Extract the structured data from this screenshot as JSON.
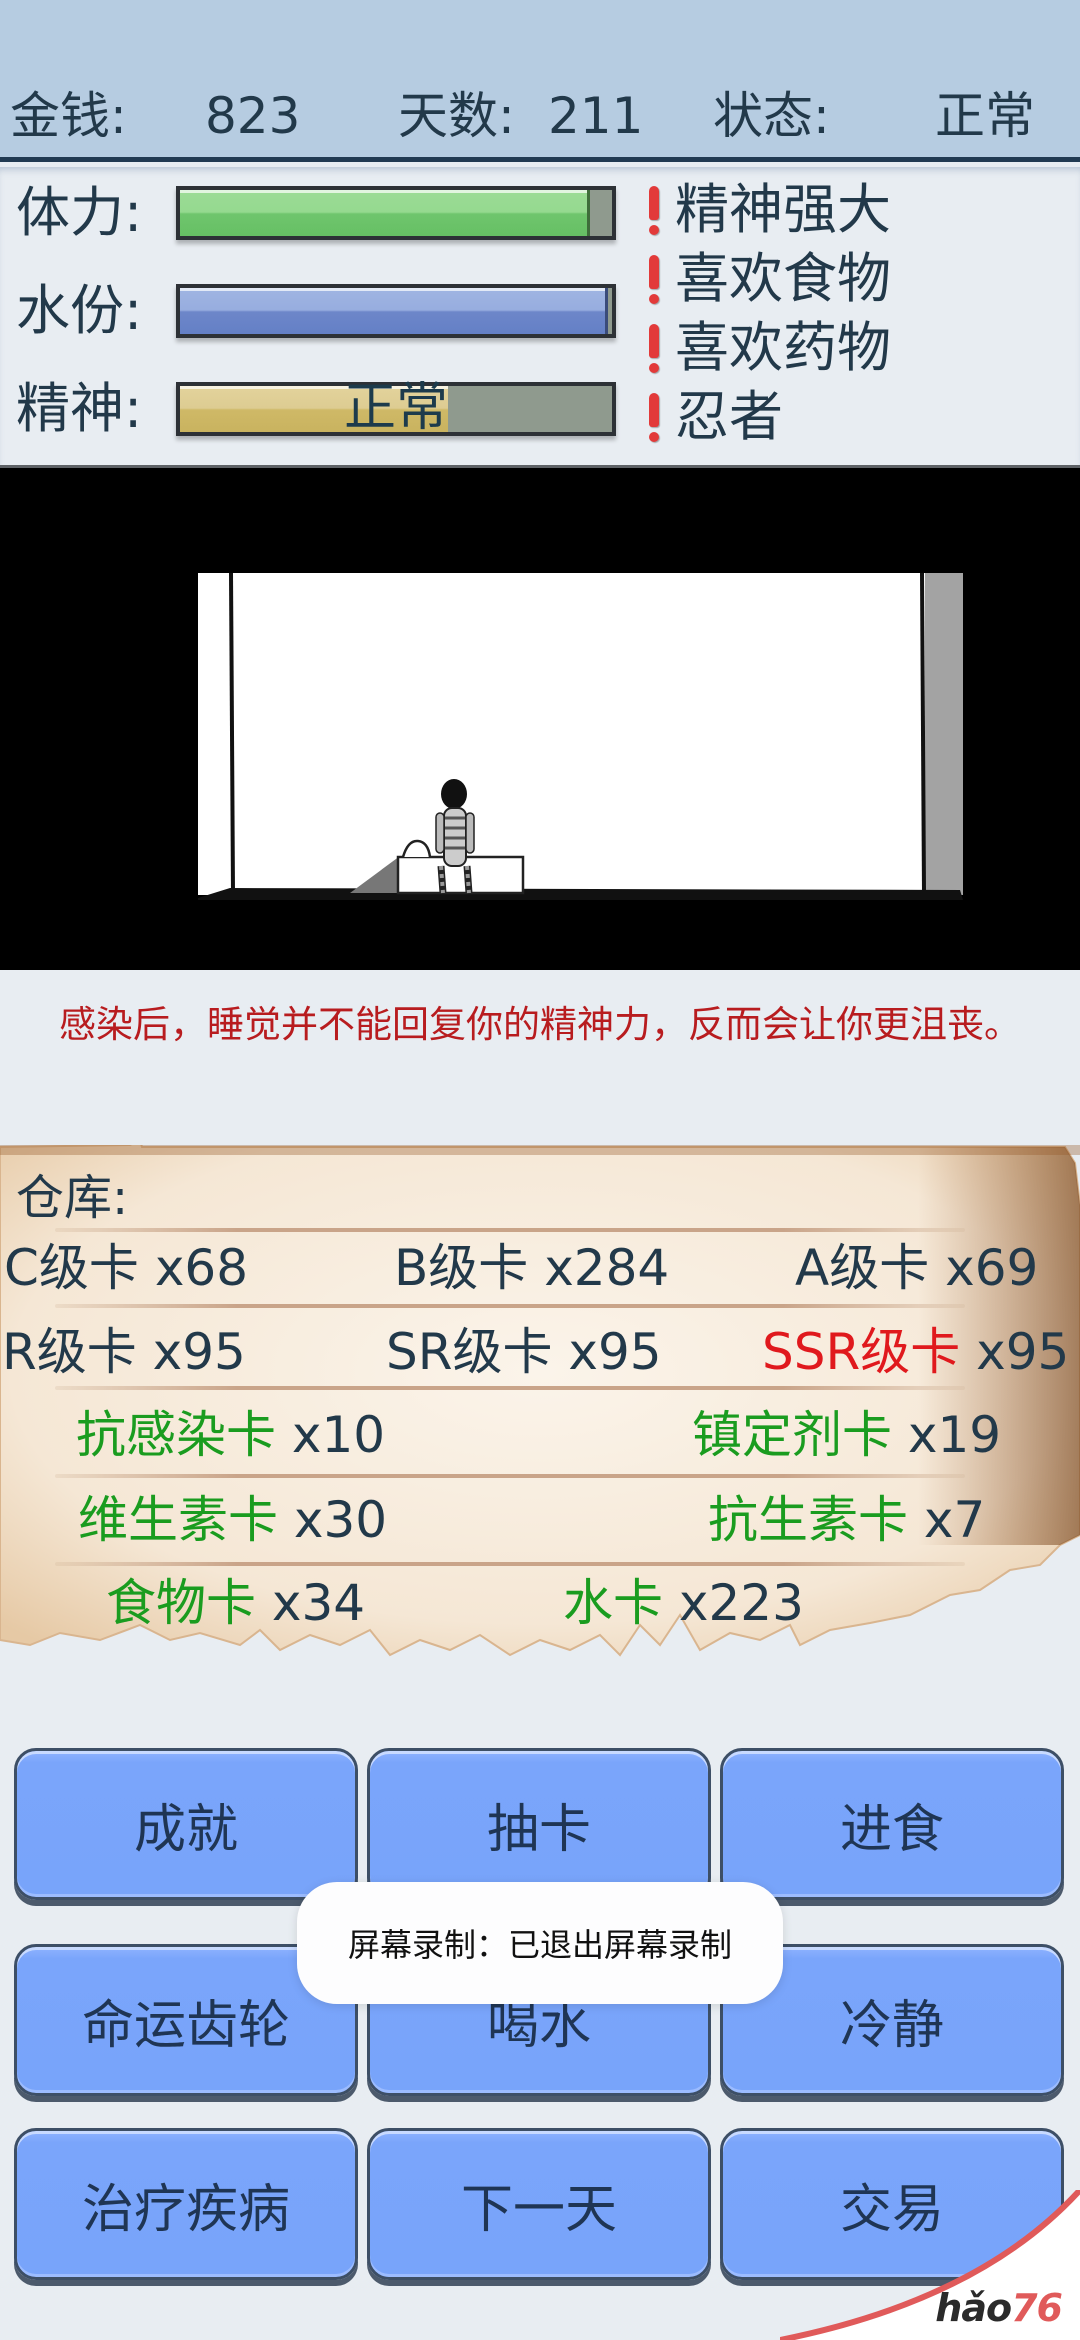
{
  "header": {
    "money_label": "金钱:",
    "money_value": "823",
    "day_label": "天数:",
    "day_value": "211",
    "state_label": "状态:",
    "state_value": "正常",
    "background": "#b6cce1"
  },
  "stats": {
    "stamina": {
      "label": "体力:",
      "fill_percent": 95,
      "color": "#6fc56d"
    },
    "water": {
      "label": "水份:",
      "fill_percent": 99,
      "color": "#6d86c9"
    },
    "spirit": {
      "label": "精神:",
      "fill_percent": 62,
      "color": "#cfb967",
      "overlay_text": "正常"
    }
  },
  "traits": [
    {
      "icon": "exclamation-icon",
      "text": "精神强大"
    },
    {
      "icon": "exclamation-icon",
      "text": "喜欢食物"
    },
    {
      "icon": "exclamation-icon",
      "text": "喜欢药物"
    },
    {
      "icon": "exclamation-icon",
      "text": "忍者"
    }
  ],
  "scene": {
    "description": "character-sitting-on-bed-in-white-room"
  },
  "message": "感染后，睡觉并不能回复你的精神力，反而会让你更沮丧。",
  "inventory": {
    "title": "仓库:",
    "items": [
      {
        "name": "C级卡",
        "count": "x68",
        "color": "default"
      },
      {
        "name": "B级卡",
        "count": "x284",
        "color": "default"
      },
      {
        "name": "A级卡",
        "count": "x69",
        "color": "default"
      },
      {
        "name": "R级卡",
        "count": "x95",
        "color": "default"
      },
      {
        "name": "SR级卡",
        "count": "x95",
        "color": "default"
      },
      {
        "name": "SSR级卡",
        "count": "x95",
        "color": "red"
      },
      {
        "name": "抗感染卡",
        "count": "x10",
        "color": "green"
      },
      {
        "name": "镇定剂卡",
        "count": "x19",
        "color": "green"
      },
      {
        "name": "维生素卡",
        "count": "x30",
        "color": "green"
      },
      {
        "name": "抗生素卡",
        "count": "x7",
        "color": "green"
      },
      {
        "name": "食物卡",
        "count": "x34",
        "color": "green"
      },
      {
        "name": "水卡",
        "count": "x223",
        "color": "green"
      }
    ]
  },
  "buttons": [
    {
      "label": "成就"
    },
    {
      "label": "抽卡"
    },
    {
      "label": "进食"
    },
    {
      "label": "命运齿轮"
    },
    {
      "label": "喝水"
    },
    {
      "label": "冷静"
    },
    {
      "label": "治疗疾病"
    },
    {
      "label": "下一天"
    },
    {
      "label": "交易"
    }
  ],
  "toast": "屏幕录制：已退出屏幕录制",
  "watermark": {
    "text": "hǎo",
    "num": "76"
  }
}
